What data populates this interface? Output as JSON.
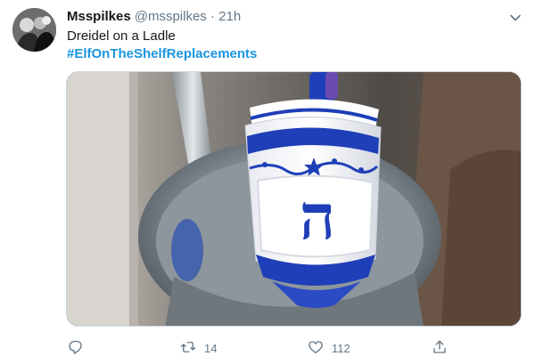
{
  "tweet": {
    "display_name": "Msspilkes",
    "handle": "@msspilkes",
    "separator": "·",
    "time": "21h",
    "text": "Dreidel on a Ladle",
    "hashtag": "#ElfOnTheShelfReplacements"
  },
  "media": {
    "description": "photo of a blue and white dreidel sitting in a metal ladle",
    "dreidel_letter": "ה"
  },
  "actions": {
    "reply_icon": "reply-icon",
    "retweet_icon": "retweet-icon",
    "retweet_count": "14",
    "like_icon": "heart-icon",
    "like_count": "112",
    "share_icon": "share-icon"
  },
  "colors": {
    "hashtag_blue": "#1b95e0",
    "muted_gray": "#657786",
    "dreidel_blue": "#1f3fb8"
  }
}
